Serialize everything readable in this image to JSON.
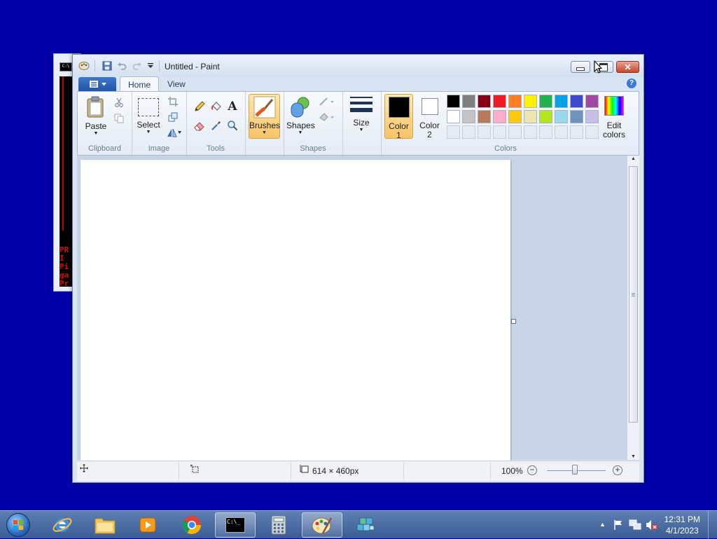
{
  "window": {
    "title": "Untitled - Paint",
    "close_glyph": "✕"
  },
  "tabs": [
    {
      "label": "Home"
    },
    {
      "label": "View"
    }
  ],
  "help_glyph": "?",
  "ribbon": {
    "clipboard": {
      "paste": "Paste",
      "group": "Clipboard"
    },
    "image": {
      "select": "Select",
      "group": "Image"
    },
    "tools": {
      "group": "Tools",
      "text_glyph": "A"
    },
    "brushes": {
      "label": "Brushes"
    },
    "shapes": {
      "label": "Shapes",
      "group": "Shapes"
    },
    "size": {
      "label": "Size"
    },
    "colors": {
      "color1_label": "Color",
      "color1_num": "1",
      "color2_label": "Color",
      "color2_num": "2",
      "edit_label": "Edit",
      "edit_label2": "colors",
      "group": "Colors",
      "color1": "#000000",
      "color2": "#ffffff",
      "palette_row1": [
        "#000000",
        "#7f7f7f",
        "#880015",
        "#ed1c24",
        "#ff7f27",
        "#fff200",
        "#22b14c",
        "#00a2e8",
        "#3f48cc",
        "#a349a4"
      ],
      "palette_row2": [
        "#ffffff",
        "#c3c3c3",
        "#b97a57",
        "#ffaec9",
        "#ffc90e",
        "#efe4b0",
        "#b5e61d",
        "#99d9ea",
        "#7092be",
        "#c8bfe7"
      ]
    }
  },
  "status": {
    "size": "614 × 460px",
    "zoom": "100%",
    "zoom_minus": "−",
    "zoom_plus": "+"
  },
  "taskbar": {
    "time": "12:31 PM",
    "date": "4/1/2023",
    "cmd_glyph": "C:\\_"
  },
  "console": {
    "icon_text": "C:\\",
    "text": "PR\nI \nPi\nga\nPr"
  }
}
